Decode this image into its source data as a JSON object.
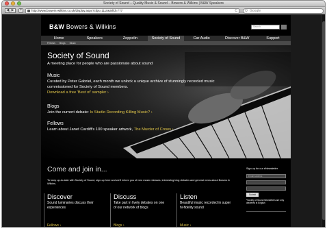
{
  "browser": {
    "title": "Society of Sound – Quality Music & Sound – Bowers & Wilkins | B&W Speakers",
    "url": "http://www.bowers-wilkins.co.uk/display.aspx?cfgs=1110&infid=777",
    "search_placeholder": "Google",
    "back_icon": "◀",
    "forward_icon": "▶",
    "add_icon": "+",
    "reload_icon": "C",
    "search_icon": "Q"
  },
  "site": {
    "logo_bold": "B&W",
    "logo_text": "Bowers & Wilkins",
    "search_placeholder": "Search"
  },
  "nav": {
    "items": [
      "Home",
      "Speakers",
      "Zeppelin",
      "Society of Sound",
      "Car Audio",
      "Discover B&W",
      "Support"
    ],
    "active_index": 3
  },
  "subnav": {
    "items": [
      "Fellows",
      "Blogs",
      "Music"
    ]
  },
  "hero": {
    "title": "Society of Sound",
    "tagline": "A meeting place for people who are passionate about sound",
    "music_heading": "Music",
    "music_text_1": "Curated by Peter Gabriel, each month we unlock a unique archive of stunningly recorded music",
    "music_text_2": "commissioned for Society of Sound members.",
    "music_link": "Download a free 'Best of' sampler ›",
    "blogs_heading": "Blogs",
    "blogs_text": "Join the current debate: ",
    "blogs_link": "Is Studio Recording Killing Music? ›",
    "fellows_heading": "Fellows",
    "fellows_text": "Learn about Janet Cardiff's 100 speaker artwork, ",
    "fellows_link": "The Murder of Crows ›"
  },
  "join": {
    "title": "Come and join in...",
    "intro": "To keep up-to-date with Society of Sound, sign-up here and we'll inform you of new music releases, interesting blog debates and general news about Bowers & Wilkins.",
    "columns": [
      {
        "title": "Discover",
        "text": "Sound luminaries discuss their experiences",
        "link": "Fellows ›"
      },
      {
        "title": "Discuss",
        "text": "Take part in lively debates on one of our network of blogs",
        "link": "Blogs ›"
      },
      {
        "title": "Listen",
        "text": "Beautiful music recorded in super hi-fidelity sound",
        "link": "Music ›"
      }
    ]
  },
  "newsletter": {
    "title": "Sign up for our eNewsletter",
    "email_placeholder": "Email Address",
    "field2_placeholder": "",
    "field3_placeholder": "",
    "submit_label": "Submit",
    "note": "*Society of Sound Newsletters are only delivered in English"
  },
  "colors": {
    "link": "#e3c84a",
    "nav_bg": "#2b2b2b",
    "active_nav": "#4a4a4a"
  }
}
